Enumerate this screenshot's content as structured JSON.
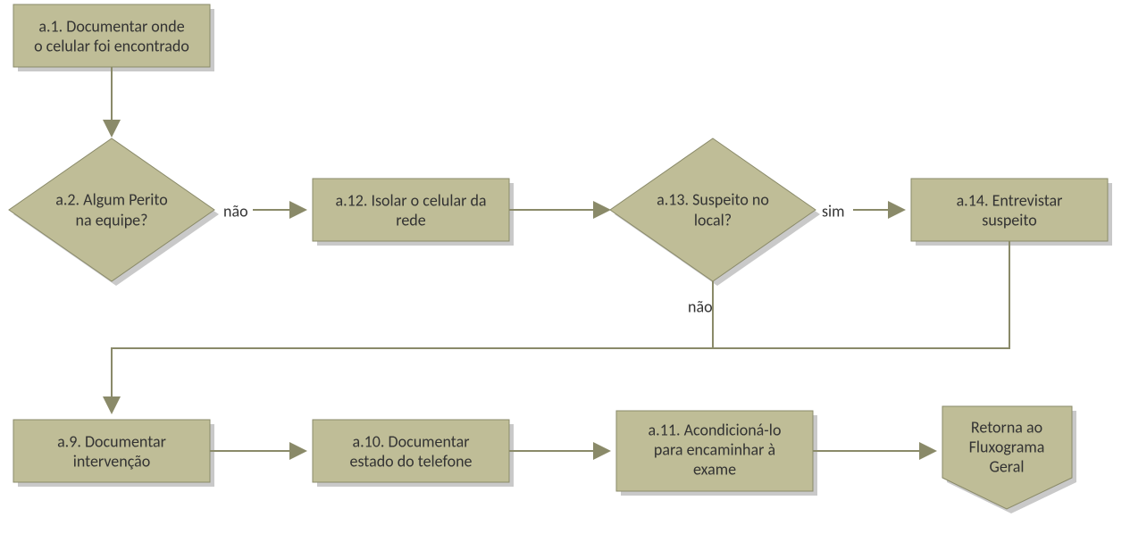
{
  "nodes": {
    "a1_line1": "a.1. Documentar onde",
    "a1_line2": "o celular foi encontrado",
    "a2_line1": "a.2. Algum Perito",
    "a2_line2": "na equipe?",
    "a12_line1": "a.12. Isolar o celular da",
    "a12_line2": "rede",
    "a13_line1": "a.13. Suspeito no",
    "a13_line2": "local?",
    "a14_line1": "a.14. Entrevistar",
    "a14_line2": "suspeito",
    "a9_line1": "a.9. Documentar",
    "a9_line2": "intervenção",
    "a10_line1": "a.10. Documentar",
    "a10_line2": "estado do telefone",
    "a11_line1": "a.11. Acondicioná-lo",
    "a11_line2": "para encaminhar à",
    "a11_line3": "exame",
    "offpage_line1": "Retorna ao",
    "offpage_line2": "Fluxograma",
    "offpage_line3": "Geral"
  },
  "labels": {
    "nao1": "não",
    "sim": "sim",
    "nao2": "não"
  },
  "colors": {
    "shape_fill": "#bfbd97",
    "shape_stroke": "#8a8a69",
    "shadow": "#c9c9c9",
    "arrow": "#8a8a69"
  }
}
